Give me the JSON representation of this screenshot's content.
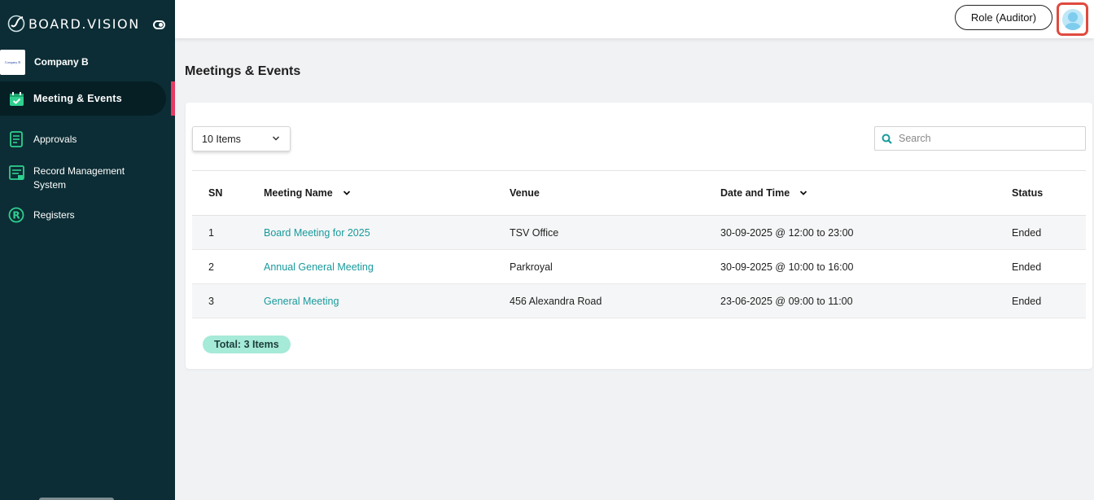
{
  "brand": {
    "name": "BOARD.VISION"
  },
  "sidebar": {
    "company": {
      "logo_text": "Company B",
      "name": "Company B"
    },
    "items": [
      {
        "label": "Meeting & Events",
        "icon": "calendar-check-icon",
        "active": true
      },
      {
        "label": "Approvals",
        "icon": "document-icon",
        "active": false
      },
      {
        "label": "Record Management System",
        "icon": "record-icon",
        "active": false
      },
      {
        "label": "Registers",
        "icon": "registered-icon",
        "active": false
      }
    ]
  },
  "topbar": {
    "role_label": "Role (Auditor)",
    "avatar_icon": "user-avatar-icon"
  },
  "page": {
    "title": "Meetings & Events"
  },
  "controls": {
    "items_select": "10 Items",
    "search_placeholder": "Search"
  },
  "table": {
    "columns": [
      "SN",
      "Meeting Name",
      "Venue",
      "Date and Time",
      "Status"
    ],
    "rows": [
      {
        "sn": "1",
        "name": "Board Meeting for 2025",
        "venue": "TSV Office",
        "datetime": "30-09-2025 @ 12:00 to 23:00",
        "status": "Ended"
      },
      {
        "sn": "2",
        "name": "Annual General Meeting",
        "venue": "Parkroyal",
        "datetime": "30-09-2025 @ 10:00 to 16:00",
        "status": "Ended"
      },
      {
        "sn": "3",
        "name": "General Meeting",
        "venue": "456 Alexandra Road",
        "datetime": "23-06-2025 @ 09:00 to 11:00",
        "status": "Ended"
      }
    ]
  },
  "footer": {
    "total": "Total: 3 Items"
  },
  "colors": {
    "sidebar": "#0c2d35",
    "accent_link": "#189a9c",
    "active_indicator": "#e63b64",
    "badge": "#a6ead8"
  }
}
